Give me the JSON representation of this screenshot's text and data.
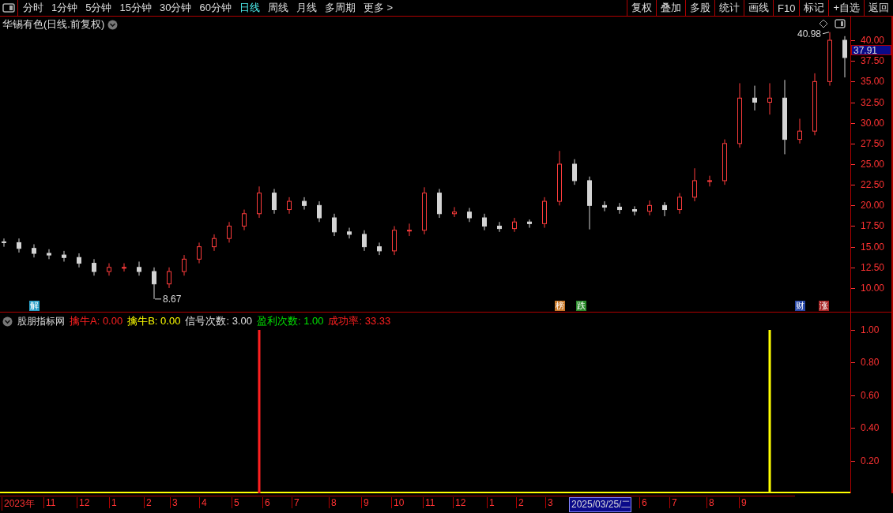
{
  "toolbar": {
    "periods": [
      {
        "label": "分时",
        "selected": false
      },
      {
        "label": "1分钟",
        "selected": false
      },
      {
        "label": "5分钟",
        "selected": false
      },
      {
        "label": "15分钟",
        "selected": false
      },
      {
        "label": "30分钟",
        "selected": false
      },
      {
        "label": "60分钟",
        "selected": false
      },
      {
        "label": "日线",
        "selected": true
      },
      {
        "label": "周线",
        "selected": false
      },
      {
        "label": "月线",
        "selected": false
      },
      {
        "label": "多周期",
        "selected": false
      },
      {
        "label": "更多 >",
        "selected": false
      }
    ],
    "buttons": [
      "复权",
      "叠加",
      "多股",
      "统计",
      "画线",
      "F10",
      "标记",
      "+自选",
      "返回"
    ]
  },
  "price_pane": {
    "title": "华锡有色(日线.前复权)",
    "last_price": "37.91",
    "chart_data": {
      "type": "candlestick",
      "ylim": [
        7.13,
        42.87
      ],
      "yticks": [
        {
          "value": 10,
          "label": "10.00"
        },
        {
          "value": 12.5,
          "label": "12.50"
        },
        {
          "value": 15,
          "label": "15.00"
        },
        {
          "value": 17.5,
          "label": "17.50"
        },
        {
          "value": 20,
          "label": "20.00"
        },
        {
          "value": 22.5,
          "label": "22.50"
        },
        {
          "value": 25,
          "label": "25.00"
        },
        {
          "value": 27.5,
          "label": "27.50"
        },
        {
          "value": 30,
          "label": "30.00"
        },
        {
          "value": 32.5,
          "label": "32.50"
        },
        {
          "value": 35,
          "label": "35.00"
        },
        {
          "value": 37.5,
          "label": "37.50"
        },
        {
          "value": 40,
          "label": "40.00"
        }
      ],
      "ohlc": [
        [
          15.6,
          16.0,
          15.0,
          15.5
        ],
        [
          15.5,
          16.0,
          14.3,
          14.8
        ],
        [
          14.8,
          15.3,
          13.7,
          14.2
        ],
        [
          14.2,
          14.7,
          13.5,
          14
        ],
        [
          14,
          14.5,
          13.2,
          13.7
        ],
        [
          13.7,
          14.2,
          12.5,
          13
        ],
        [
          13,
          13.5,
          11.5,
          12
        ],
        [
          12,
          13,
          11.5,
          12.5
        ],
        [
          12.5,
          13,
          12,
          12.5
        ],
        [
          12.5,
          13.2,
          11.5,
          12
        ],
        [
          12,
          12.5,
          8.67,
          10.5
        ],
        [
          10.5,
          12.5,
          10,
          12
        ],
        [
          12,
          14,
          11.5,
          13.5
        ],
        [
          13.5,
          15.5,
          13,
          15
        ],
        [
          15,
          16.5,
          14.5,
          16
        ],
        [
          16,
          18,
          15.5,
          17.5
        ],
        [
          17.5,
          19.5,
          17,
          19
        ],
        [
          19,
          22.3,
          18.5,
          21.5
        ],
        [
          21.5,
          22,
          19,
          19.5
        ],
        [
          19.5,
          21,
          19,
          20.5
        ],
        [
          20.5,
          21,
          19.5,
          20
        ],
        [
          20,
          20.5,
          18,
          18.5
        ],
        [
          18.5,
          19,
          16.3,
          16.8
        ],
        [
          16.8,
          17.3,
          16,
          16.5
        ],
        [
          16.5,
          17,
          14.5,
          15
        ],
        [
          15,
          15.5,
          14,
          14.5
        ],
        [
          14.5,
          17.5,
          14,
          17
        ],
        [
          17,
          17.8,
          16.3,
          17
        ],
        [
          17,
          22.2,
          16.5,
          21.5
        ],
        [
          21.5,
          22,
          18.5,
          19
        ],
        [
          19,
          19.8,
          18.6,
          19.2
        ],
        [
          19.2,
          19.7,
          18,
          18.5
        ],
        [
          18.5,
          19,
          17,
          17.5
        ],
        [
          17.5,
          18,
          16.8,
          17.2
        ],
        [
          17.2,
          18.5,
          16.8,
          18
        ],
        [
          18,
          18.3,
          17.3,
          17.8
        ],
        [
          17.8,
          21,
          17.3,
          20.5
        ],
        [
          20.5,
          26.6,
          20,
          25
        ],
        [
          25,
          25.6,
          22.5,
          23
        ],
        [
          23,
          23.5,
          17.1,
          20
        ],
        [
          20,
          20.5,
          19.3,
          19.8
        ],
        [
          19.8,
          20.3,
          19,
          19.5
        ],
        [
          19.5,
          19.9,
          18.8,
          19.3
        ],
        [
          19.3,
          20.6,
          18.8,
          20
        ],
        [
          20,
          20.4,
          18.7,
          19.5
        ],
        [
          19.5,
          21.5,
          19,
          21
        ],
        [
          21,
          24.5,
          20.5,
          23
        ],
        [
          23,
          23.6,
          22.3,
          23
        ],
        [
          23,
          28,
          22.5,
          27.5
        ],
        [
          27.5,
          34.8,
          27,
          33
        ],
        [
          33,
          34.5,
          31.5,
          32.5
        ],
        [
          32.5,
          34.8,
          31,
          33
        ],
        [
          33,
          35.2,
          26.2,
          28
        ],
        [
          28,
          30.5,
          27.5,
          29
        ],
        [
          29,
          36,
          28.5,
          35
        ],
        [
          35,
          40.98,
          34.5,
          40
        ],
        [
          40,
          40.5,
          35.5,
          37.91
        ]
      ],
      "annotations": [
        "40.98",
        "8.67"
      ]
    },
    "markers": [
      {
        "label": "解",
        "color": "#2aa0c8"
      },
      {
        "label": "榜",
        "color": "#c87828"
      },
      {
        "label": "跌",
        "color": "#2a8a2a"
      },
      {
        "label": "财",
        "color": "#2848a8"
      },
      {
        "label": "涨",
        "color": "#a82828"
      }
    ]
  },
  "indicator_pane": {
    "name": "股朋指标网",
    "legend": [
      {
        "label": "擒牛A:",
        "value": "0.00",
        "color": "#ff2020"
      },
      {
        "label": "擒牛B:",
        "value": "0.00",
        "color": "#ffff00"
      },
      {
        "label": "信号次数:",
        "value": "3.00",
        "color": "#e0e0e0"
      },
      {
        "label": "盈利次数:",
        "value": "1.00",
        "color": "#00e000"
      },
      {
        "label": "成功率:",
        "value": "33.33",
        "color": "#ff2020"
      }
    ],
    "chart_data": {
      "type": "bar",
      "ylim": [
        0,
        1.1
      ],
      "yticks": [
        {
          "value": 0.2,
          "label": "0.20"
        },
        {
          "value": 0.4,
          "label": "0.40"
        },
        {
          "value": 0.6,
          "label": "0.60"
        },
        {
          "value": 0.8,
          "label": "0.80"
        },
        {
          "value": 1.0,
          "label": "1.00"
        }
      ],
      "series": [
        {
          "color": "#ff2020",
          "values": [
            0,
            0,
            0,
            0,
            0,
            0,
            0,
            0,
            0,
            0,
            0,
            0,
            0,
            0,
            0,
            0,
            0,
            1,
            0,
            0,
            0,
            0,
            0,
            0,
            0,
            0,
            0,
            0,
            0,
            0,
            0,
            0,
            0,
            0,
            0,
            0,
            0,
            0,
            0,
            0,
            0,
            0,
            0,
            0,
            0,
            0,
            0,
            0,
            0,
            0,
            0,
            0,
            0,
            0,
            0,
            0,
            0
          ]
        },
        {
          "color": "#ffff00",
          "values": [
            0,
            0,
            0,
            0,
            0,
            0,
            0,
            0,
            0,
            0,
            0,
            0,
            0,
            0,
            0,
            0,
            0,
            0,
            0,
            0,
            0,
            0,
            0,
            0,
            0,
            0,
            0,
            0,
            0,
            0,
            0,
            0,
            0,
            0,
            0,
            0,
            0,
            0,
            0,
            0,
            0,
            0,
            0,
            0,
            0,
            0,
            0,
            0,
            0,
            0,
            0,
            1,
            0,
            0,
            0,
            0,
            0
          ]
        }
      ]
    }
  },
  "time_axis": [
    {
      "label": "2023年",
      "selected": false
    },
    {
      "label": "11",
      "selected": false
    },
    {
      "label": "12",
      "selected": false
    },
    {
      "label": "1",
      "selected": false
    },
    {
      "label": "2",
      "selected": false
    },
    {
      "label": "3",
      "selected": false
    },
    {
      "label": "4",
      "selected": false
    },
    {
      "label": "5",
      "selected": false
    },
    {
      "label": "6",
      "selected": false
    },
    {
      "label": "7",
      "selected": false
    },
    {
      "label": "8",
      "selected": false
    },
    {
      "label": "9",
      "selected": false
    },
    {
      "label": "10",
      "selected": false
    },
    {
      "label": "11",
      "selected": false
    },
    {
      "label": "12",
      "selected": false
    },
    {
      "label": "1",
      "selected": false
    },
    {
      "label": "2",
      "selected": false
    },
    {
      "label": "3",
      "selected": false
    },
    {
      "label": "2025/03/25/二",
      "selected": true
    },
    {
      "label": "6",
      "selected": false
    },
    {
      "label": "7",
      "selected": false
    },
    {
      "label": "8",
      "selected": false
    },
    {
      "label": "9",
      "selected": false
    }
  ]
}
